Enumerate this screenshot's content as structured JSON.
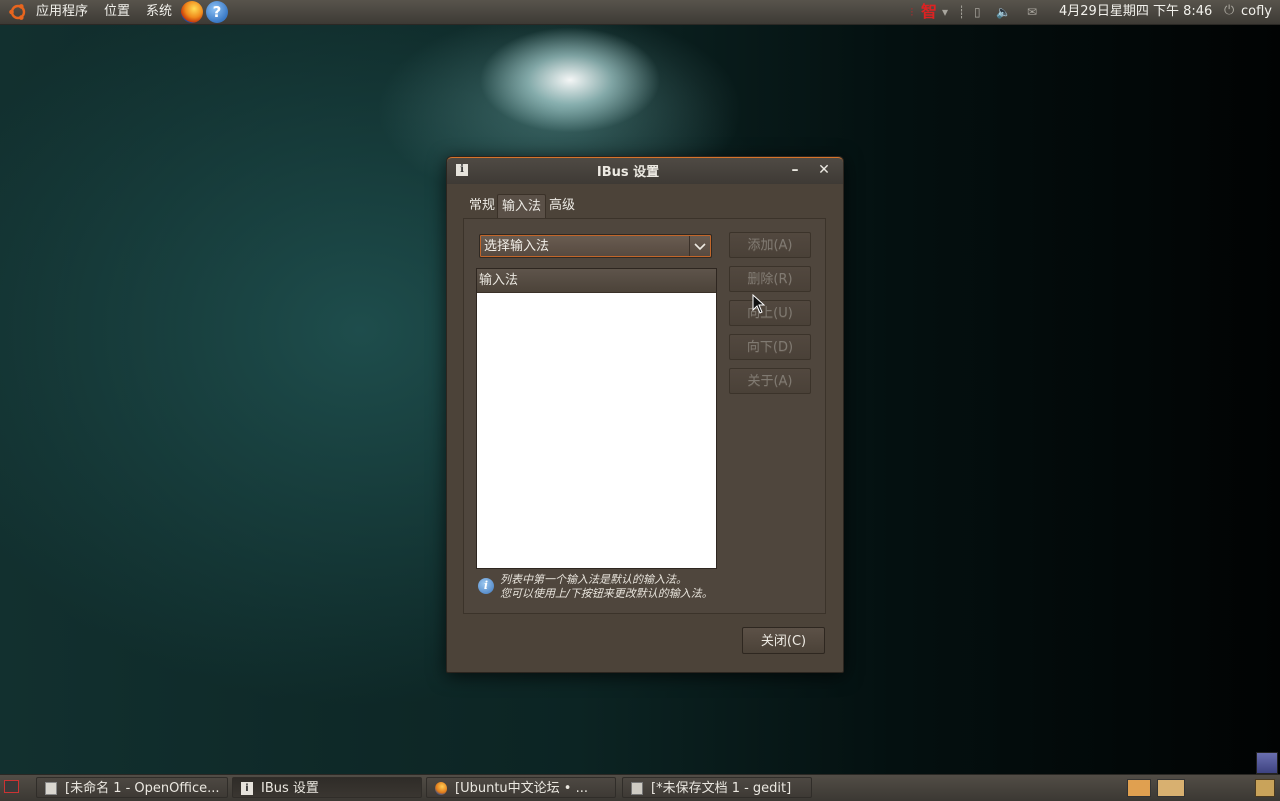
{
  "top_panel": {
    "menu_applications": "应用程序",
    "menu_places": "位置",
    "menu_system": "系统",
    "ime_indicator": "智",
    "clock": "4月29日星期四 下午 8:46",
    "user": "cofly"
  },
  "window": {
    "title": "IBus 设置",
    "tabs": [
      "常规",
      "输入法",
      "高级"
    ],
    "active_tab": "输入法",
    "combo_value": "选择输入法",
    "list_header": "输入法",
    "buttons": {
      "add": "添加(A)",
      "remove": "删除(R)",
      "up": "向上(U)",
      "down": "向下(D)",
      "about": "关于(A)"
    },
    "info_line1": "列表中第一个输入法是默认的输入法。",
    "info_line2": "您可以使用上/下按钮来更改默认的输入法。",
    "close_button": "关闭(C)"
  },
  "taskbar": {
    "tasks": [
      "[未命名 1 - OpenOffice...",
      "IBus 设置",
      "[Ubuntu中文论坛 • ...",
      "[*未保存文档 1 - gedit]"
    ]
  },
  "colors": {
    "accent": "#d7742a",
    "window_bg": "#4c4339"
  }
}
